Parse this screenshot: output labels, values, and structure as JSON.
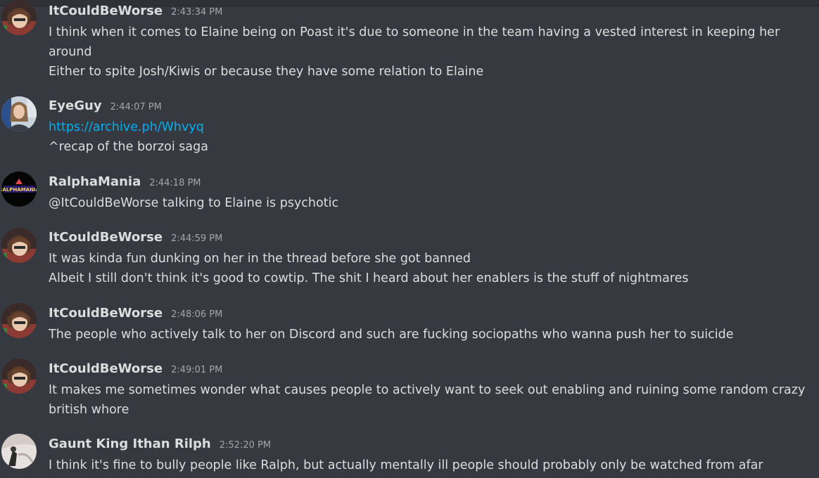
{
  "messages": [
    {
      "username": "ItCouldBeWorse",
      "timestamp": "2:43:34 PM",
      "avatar": "anime-character-avatar",
      "lines": [
        "I think when it comes to Elaine being on Poast it's due to someone in the team having a vested interest in keeping her around",
        "Either to spite Josh/Kiwis or because they have some relation to Elaine"
      ]
    },
    {
      "username": "EyeGuy",
      "timestamp": "2:44:07 PM",
      "avatar": "woman-photo-avatar",
      "lines": [
        "https://archive.ph/Whvyq",
        "^recap of the borzoi saga"
      ]
    },
    {
      "username": "RalphaMania",
      "timestamp": "2:44:18 PM",
      "avatar": "ralphamania-logo-avatar",
      "avatar_text": "RALPHAMANIA",
      "lines": [
        "@ItCouldBeWorse talking to Elaine is psychotic"
      ]
    },
    {
      "username": "ItCouldBeWorse",
      "timestamp": "2:44:59 PM",
      "avatar": "anime-character-avatar",
      "lines": [
        "It was kinda fun dunking on her in the thread before she got banned",
        "Albeit I still don't think it's good to cowtip. The shit I heard about her enablers is the stuff of nightmares"
      ]
    },
    {
      "username": "ItCouldBeWorse",
      "timestamp": "2:48:06 PM",
      "avatar": "anime-character-avatar",
      "lines": [
        "The people who actively talk to her on Discord and such are fucking sociopaths who wanna push her to suicide"
      ]
    },
    {
      "username": "ItCouldBeWorse",
      "timestamp": "2:49:01 PM",
      "avatar": "anime-character-avatar",
      "lines": [
        "It makes me sometimes wonder what causes people to actively want to seek out enabling and ruining some random crazy british whore"
      ]
    },
    {
      "username": "Gaunt King Ithan Rilph",
      "timestamp": "2:52:20 PM",
      "avatar": "knight-figure-avatar",
      "lines": [
        "I think it's fine to bully people like Ralph, but actually mentally ill people should probably only be watched from afar"
      ]
    }
  ],
  "colors": {
    "background": "#36393f",
    "text": "#dcddde",
    "timestamp": "#a3a6aa",
    "link": "#00aff4"
  }
}
